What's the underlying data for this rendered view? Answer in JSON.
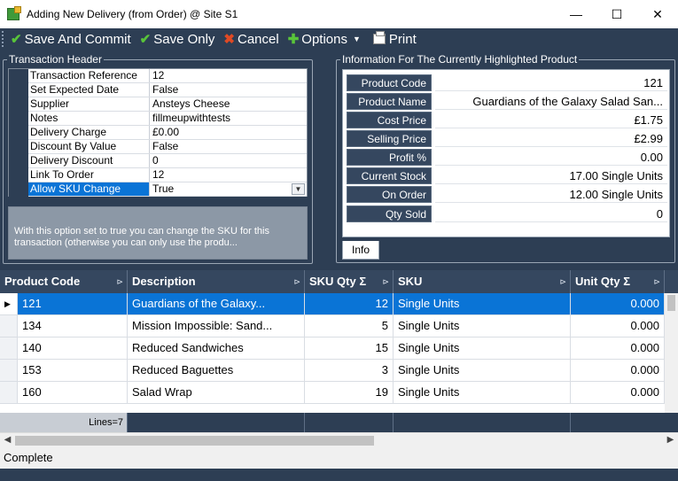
{
  "window": {
    "title": "Adding New Delivery (from Order) @ Site S1",
    "minimize": "—",
    "maximize": "☐",
    "close": "✕"
  },
  "toolbar": {
    "save_commit": "Save And Commit",
    "save_only": "Save Only",
    "cancel": "Cancel",
    "options": "Options",
    "print": "Print"
  },
  "header_group": {
    "title": "Transaction Header",
    "rows": [
      {
        "name": "Transaction Reference",
        "value": "12"
      },
      {
        "name": "Set Expected Date",
        "value": "False"
      },
      {
        "name": "Supplier",
        "value": "Ansteys Cheese"
      },
      {
        "name": "Notes",
        "value": "fillmeupwithtests"
      },
      {
        "name": "Delivery Charge",
        "value": "£0.00"
      },
      {
        "name": "Discount By Value",
        "value": "False"
      },
      {
        "name": "Delivery Discount",
        "value": "0"
      },
      {
        "name": "Link To Order",
        "value": "12"
      },
      {
        "name": "Allow SKU Change",
        "value": "True"
      }
    ],
    "description": "With this option set to true you can change the SKU for this transaction (otherwise you can only use the produ..."
  },
  "info_group": {
    "title": "Information For The Currently Highlighted Product",
    "rows": [
      {
        "label": "Product Code",
        "value": "121"
      },
      {
        "label": "Product Name",
        "value": "Guardians of the Galaxy Salad San..."
      },
      {
        "label": "Cost Price",
        "value": "£1.75"
      },
      {
        "label": "Selling Price",
        "value": "£2.99"
      },
      {
        "label": "Profit %",
        "value": "0.00"
      },
      {
        "label": "Current Stock",
        "value": "17.00 Single Units"
      },
      {
        "label": "On Order",
        "value": "12.00 Single Units"
      },
      {
        "label": "Qty Sold",
        "value": "0"
      }
    ],
    "tab": "Info"
  },
  "grid": {
    "columns": [
      "Product Code",
      "Description",
      "SKU Qty",
      "SKU",
      "Unit Qty"
    ],
    "rows": [
      {
        "code": "121",
        "desc": "Guardians of the Galaxy...",
        "qty": "12",
        "sku": "Single Units",
        "unit": "0.000"
      },
      {
        "code": "134",
        "desc": "Mission Impossible: Sand...",
        "qty": "5",
        "sku": "Single Units",
        "unit": "0.000"
      },
      {
        "code": "140",
        "desc": "Reduced Sandwiches",
        "qty": "15",
        "sku": "Single Units",
        "unit": "0.000"
      },
      {
        "code": "153",
        "desc": "Reduced Baguettes",
        "qty": "3",
        "sku": "Single Units",
        "unit": "0.000"
      },
      {
        "code": "160",
        "desc": "Salad Wrap",
        "qty": "19",
        "sku": "Single Units",
        "unit": "0.000"
      }
    ],
    "footer": "Lines=7"
  },
  "status": "Complete",
  "colors": {
    "accent": "#0a74d6",
    "frame": "#2d3e54",
    "header": "#35475f"
  }
}
